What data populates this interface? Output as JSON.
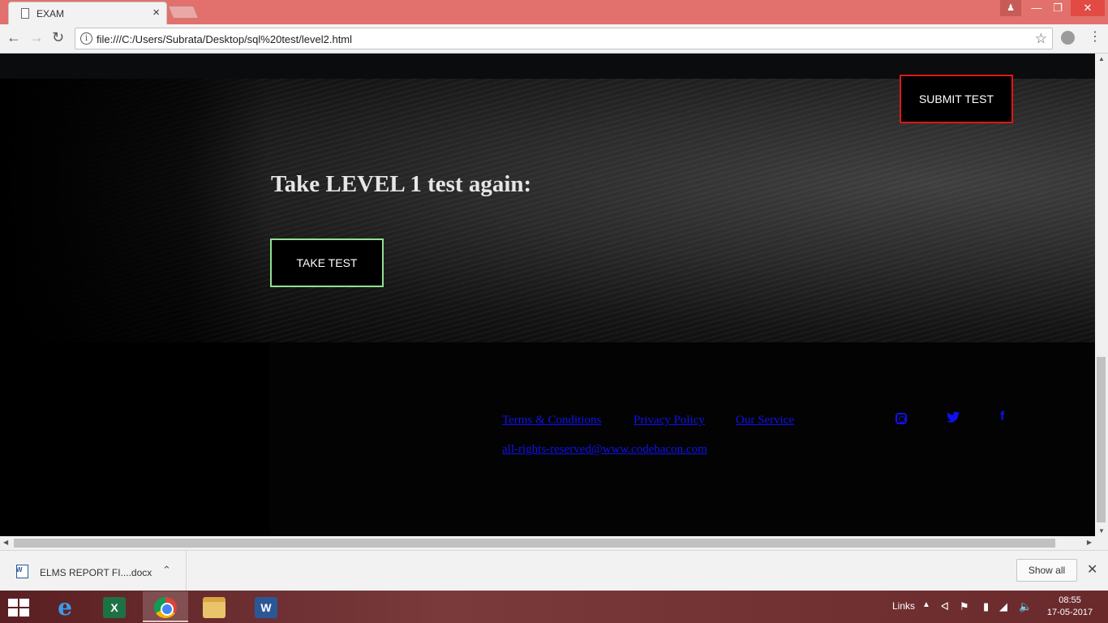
{
  "browser": {
    "tab_title": "EXAM",
    "url": "file:///C:/Users/Subrata/Desktop/sql%20test/level2.html"
  },
  "page": {
    "submit_label": "SUBMIT TEST",
    "heading": "Take LEVEL 1 test again:",
    "take_test_label": "TAKE TEST",
    "footer": {
      "links": [
        "Terms & Conditions",
        "Privacy Policy",
        "Our Service"
      ],
      "rights": "all-rights-reserved@www.codebacon.com",
      "social": [
        "instagram-icon",
        "twitter-icon",
        "facebook-icon"
      ],
      "facebook_glyph": "f"
    },
    "colors": {
      "submit_border": "#e01616",
      "take_test_border": "#8fe28f",
      "link": "#1010ee"
    }
  },
  "downloads": {
    "file_name": "ELMS REPORT FI....docx",
    "show_all": "Show all"
  },
  "taskbar": {
    "links_label": "Links",
    "time": "08:55",
    "date": "17-05-2017"
  }
}
